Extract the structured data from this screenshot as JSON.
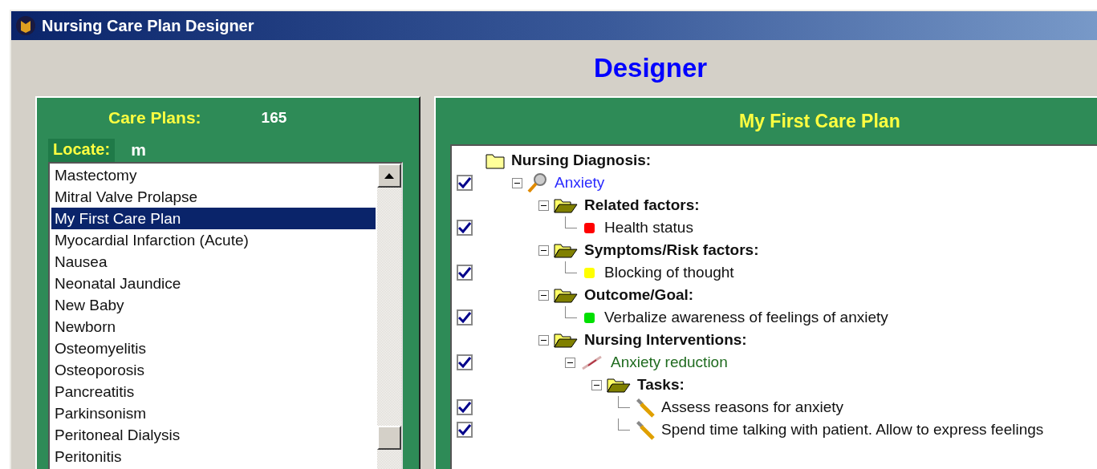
{
  "window": {
    "title": "Nursing Care Plan Designer"
  },
  "heading": "Designer",
  "care_plans": {
    "label": "Care Plans:",
    "count": "165",
    "locate_label": "Locate:",
    "locate_value": "m",
    "items": [
      {
        "label": "Mastectomy",
        "selected": false
      },
      {
        "label": "Mitral Valve Prolapse",
        "selected": false
      },
      {
        "label": "My First Care Plan",
        "selected": true
      },
      {
        "label": "Myocardial Infarction (Acute)",
        "selected": false
      },
      {
        "label": "Nausea",
        "selected": false
      },
      {
        "label": "Neonatal Jaundice",
        "selected": false
      },
      {
        "label": "New Baby",
        "selected": false
      },
      {
        "label": "Newborn",
        "selected": false
      },
      {
        "label": "Osteomyelitis",
        "selected": false
      },
      {
        "label": "Osteoporosis",
        "selected": false
      },
      {
        "label": "Pancreatitis",
        "selected": false
      },
      {
        "label": "Parkinsonism",
        "selected": false
      },
      {
        "label": "Peritoneal Dialysis",
        "selected": false
      },
      {
        "label": "Peritonitis",
        "selected": false
      }
    ]
  },
  "plan": {
    "title": "My First Care Plan",
    "tree": [
      {
        "kind": "root",
        "label": "Nursing Diagnosis:",
        "children": [
          {
            "kind": "diagnosis",
            "label": "Anxiety",
            "checked": true,
            "expanded": true,
            "children": [
              {
                "kind": "group",
                "label": "Related factors:",
                "expanded": true,
                "children": [
                  {
                    "kind": "factor",
                    "label": "Health status",
                    "checked": true,
                    "color": "#ff0000"
                  }
                ]
              },
              {
                "kind": "group",
                "label": "Symptoms/Risk factors:",
                "expanded": true,
                "children": [
                  {
                    "kind": "factor",
                    "label": "Blocking of thought",
                    "checked": true,
                    "color": "#ffff00"
                  }
                ]
              },
              {
                "kind": "group",
                "label": "Outcome/Goal:",
                "expanded": true,
                "children": [
                  {
                    "kind": "factor",
                    "label": "Verbalize awareness of feelings of anxiety",
                    "checked": true,
                    "color": "#00e000"
                  }
                ]
              },
              {
                "kind": "group",
                "label": "Nursing Interventions:",
                "expanded": true,
                "children": [
                  {
                    "kind": "intervention",
                    "label": "Anxiety reduction",
                    "checked": true,
                    "expanded": true,
                    "children": [
                      {
                        "kind": "group",
                        "label": "Tasks:",
                        "expanded": true,
                        "children": [
                          {
                            "kind": "task",
                            "label": "Assess reasons for anxiety",
                            "checked": true
                          },
                          {
                            "kind": "task",
                            "label": "Spend time talking with patient. Allow to express feelings",
                            "checked": true
                          }
                        ]
                      }
                    ]
                  }
                ]
              }
            ]
          }
        ]
      }
    ]
  }
}
